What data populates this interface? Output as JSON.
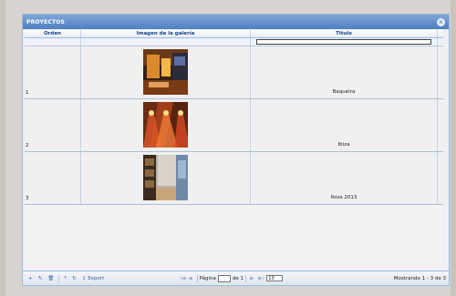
{
  "panel": {
    "title": "PROYECTOS",
    "close_icon": "close-icon"
  },
  "columns": [
    "Orden",
    "Imagen de la galería",
    "Titulo"
  ],
  "filter": {
    "titulo_value": "",
    "titulo_placeholder": ""
  },
  "rows": [
    {
      "orden": "1",
      "titulo": "Baqueira",
      "image": "interior-photo-warm"
    },
    {
      "orden": "2",
      "titulo": "Ibiza",
      "image": "wall-lights-photo"
    },
    {
      "orden": "3",
      "titulo": "Ibiza 2013",
      "image": "interior-photo-cool"
    }
  ],
  "toolbar": {
    "add_icon": "plus-icon",
    "edit_icon": "pencil-icon",
    "delete_icon": "trash-icon",
    "search_icon": "search-icon",
    "refresh_icon": "refresh-icon",
    "export_label": "Export",
    "page_label": "Página",
    "page_value": "1",
    "of_label": "de 1",
    "page_size": "10",
    "status_text": "Mostrando 1 - 3 de 3"
  }
}
